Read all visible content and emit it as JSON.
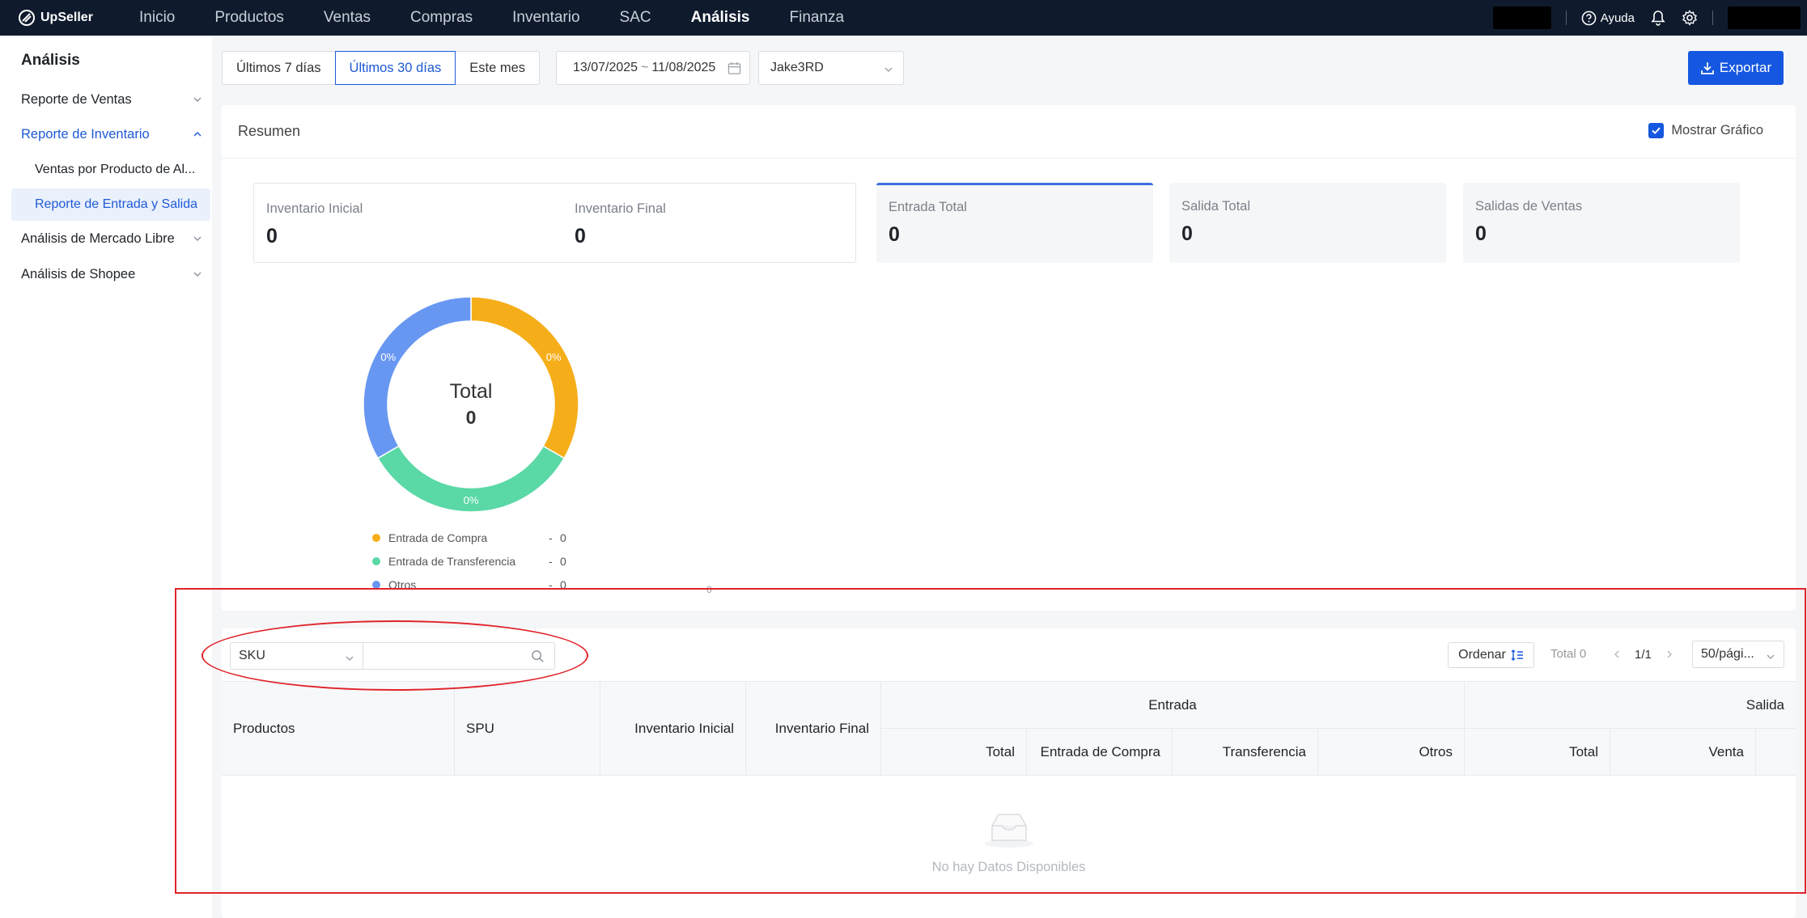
{
  "app": {
    "brand": "UpSeller"
  },
  "topnav": {
    "items": [
      "Inicio",
      "Productos",
      "Ventas",
      "Compras",
      "Inventario",
      "SAC",
      "Análisis",
      "Finanza"
    ],
    "active": "Análisis",
    "help_label": "Ayuda"
  },
  "sidebar": {
    "title": "Análisis",
    "items": [
      {
        "label": "Reporte de Ventas"
      },
      {
        "label": "Reporte de Inventario"
      },
      {
        "label": "Ventas por Producto de Al..."
      },
      {
        "label": "Reporte de Entrada y Salida"
      },
      {
        "label": "Análisis de Mercado Libre"
      },
      {
        "label": "Análisis de Shopee"
      }
    ]
  },
  "filters": {
    "ranges": [
      "Últimos 7 días",
      "Últimos 30 días",
      "Este mes"
    ],
    "selected_range": "Últimos 30 días",
    "date_from": "13/07/2025",
    "date_sep": "~",
    "date_to": "11/08/2025",
    "store": "Jake3RD",
    "export_label": "Exportar"
  },
  "summary": {
    "title": "Resumen",
    "show_chart_label": "Mostrar Gráfico",
    "show_chart_checked": true,
    "cards": [
      {
        "label": "Inventario Inicial",
        "value": "0"
      },
      {
        "label": "Inventario Final",
        "value": "0"
      },
      {
        "label": "Entrada Total",
        "value": "0"
      },
      {
        "label": "Salida Total",
        "value": "0"
      },
      {
        "label": "Salidas de Ventas",
        "value": "0"
      }
    ],
    "donut": {
      "total_label": "Total",
      "total_value": "0",
      "slices": [
        {
          "name": "Entrada de Compra",
          "percent_label": "0%",
          "color": "#f5ae1a",
          "share": 0.3333
        },
        {
          "name": "Entrada de Transferencia",
          "percent_label": "0%",
          "color": "#5ad8a6",
          "share": 0.3333
        },
        {
          "name": "Otros",
          "percent_label": "0%",
          "color": "#6897f2",
          "share": 0.3334
        }
      ],
      "legend": [
        {
          "name": "Entrada de Compra",
          "dash": "-",
          "value": "0",
          "color": "#f5ae1a"
        },
        {
          "name": "Entrada de Transferencia",
          "dash": "-",
          "value": "0",
          "color": "#5ad8a6"
        },
        {
          "name": "Otros",
          "dash": "-",
          "value": "0",
          "color": "#6897f2"
        }
      ],
      "axis_zero": "0"
    }
  },
  "table": {
    "search_field": "SKU",
    "search_value": "",
    "order_label": "Ordenar",
    "total_text": "Total 0",
    "pages_text": "1/1",
    "page_size": "50/pági...",
    "headers": {
      "productos": "Productos",
      "spu": "SPU",
      "inventario_inicial": "Inventario Inicial",
      "inventario_final": "Inventario Final",
      "entrada": "Entrada",
      "salida": "Salida",
      "entrada_total": "Total",
      "entrada_compra": "Entrada de Compra",
      "transferencia": "Transferencia",
      "otros": "Otros",
      "salida_total": "Total",
      "venta": "Venta"
    },
    "empty_text": "No hay Datos Disponibles"
  }
}
